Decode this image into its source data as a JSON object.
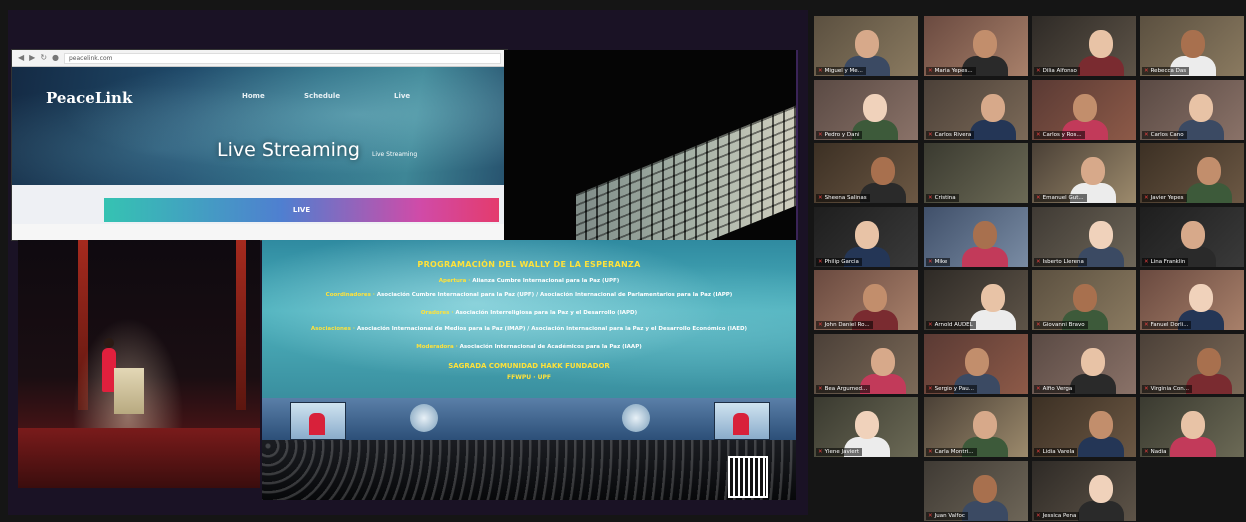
{
  "browser": {
    "url": "peacelink.com",
    "brand": "PeaceLink",
    "nav": [
      "Home",
      "Schedule",
      "Live"
    ],
    "hero_title": "Live Streaming",
    "hero_subtitle": "Live Streaming",
    "live_button": "LIVE"
  },
  "program": {
    "title": "PROGRAMACIÓN DEL WALLY DE LA ESPERANZA",
    "rows": [
      {
        "label": "Apertura",
        "text": "Alianza Cumbre Internacional para la Paz (UPF)"
      },
      {
        "label": "Coordinadores",
        "text": "Asociación Cumbre Internacional para la Paz (UPF) / Asociación Internacional de Parlamentarios para la Paz (IAPP)"
      },
      {
        "label": "Oradores",
        "text": "Asociación Interreligiosa para la Paz y el Desarrollo (IAPD)"
      },
      {
        "label": "Asociaciones",
        "text": "Asociación Internacional de Medios para la Paz (IMAP) / Asociación Internacional para la Paz y el Desarrollo Económico (IAED)"
      },
      {
        "label": "Moderadora",
        "text": "Asociación Internacional de Académicos para la Paz (IAAP)"
      }
    ],
    "footer_line1": "SAGRADA COMUNIDAD HAKK FUNDADOR",
    "footer_line2": "FFWPU · UPF"
  },
  "participants": [
    "Miguel y Me...",
    "Maria Yepes...",
    "Dilia Alfonso",
    "Rebecca Das",
    "Pedro y Dani",
    "Carlos Rivera",
    "Carlos y Ros...",
    "Carlos Cano",
    "Sheena Salinas",
    "Cristina",
    "Emanuel Gut...",
    "Javier Yepes",
    "Philip Garcia",
    "Mike",
    "Isberto Llerena",
    "Lina Franklin",
    "John Daniel Ro...",
    "Arnold AUDEL",
    "Giovanni Bravo",
    "Fanuel Dorli...",
    "Bea Argumed...",
    "Sergio y Pau...",
    "Alfio Verga",
    "Virginia Con...",
    "Ylene Javiert",
    "Carla Montri...",
    "Lidia Varela",
    "Nadia",
    "Juan Valfoc",
    "Jessica Pena"
  ]
}
